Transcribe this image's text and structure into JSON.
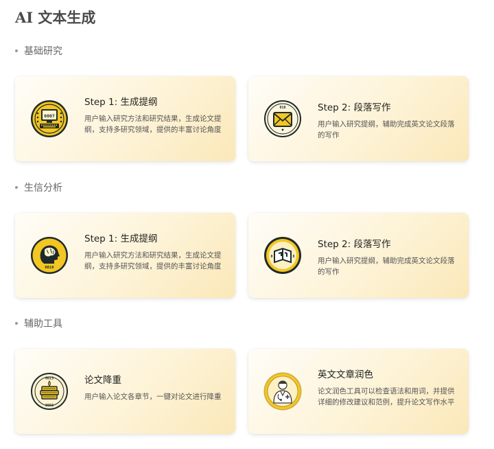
{
  "page": {
    "title": "AI 文本生成"
  },
  "sections": [
    {
      "title": "基础研究",
      "cards": [
        {
          "title": "Step 1: 生成提纲",
          "desc": "用户输入研究方法和研究结果，生成论文提纲，支持多研究领域，提供的丰富讨论角度",
          "icon": "computer-badge-icon"
        },
        {
          "title": "Step 2: 段落写作",
          "desc": "用户输入研究提纲，辅助完成英文论文段落的写作",
          "icon": "envelope-badge-icon"
        }
      ]
    },
    {
      "title": "生信分析",
      "cards": [
        {
          "title": "Step 1: 生成提纲",
          "desc": "用户输入研究方法和研究结果，生成论文提纲，支持多研究领域，提供的丰富讨论角度",
          "icon": "brain-head-badge-icon"
        },
        {
          "title": "Step 2: 段落写作",
          "desc": "用户输入研究提纲，辅助完成英文论文段落的写作",
          "icon": "book-badge-icon"
        }
      ]
    },
    {
      "title": "辅助工具",
      "cards": [
        {
          "title": "论文降重",
          "desc": "用户输入论文各章节，一键对论文进行降重",
          "icon": "book-stack-badge-icon"
        },
        {
          "title": "英文文章润色",
          "desc": "论文润色工具可以检查语法和用词，并提供详细的修改建议和范例，提升论文写作水平",
          "icon": "doctor-badge-icon"
        }
      ]
    }
  ],
  "badge_text": {
    "computer": "0007",
    "envelope": "010",
    "brain": "0018",
    "book_left": "0",
    "book_right": "8",
    "stack_top": "0013",
    "stack_bottom": "0003"
  },
  "colors": {
    "badge_yellow": "#f3c623",
    "badge_dark": "#1f2a2a",
    "card_gradient_start": "#fffdf8",
    "card_gradient_end": "#fbe8b9"
  }
}
